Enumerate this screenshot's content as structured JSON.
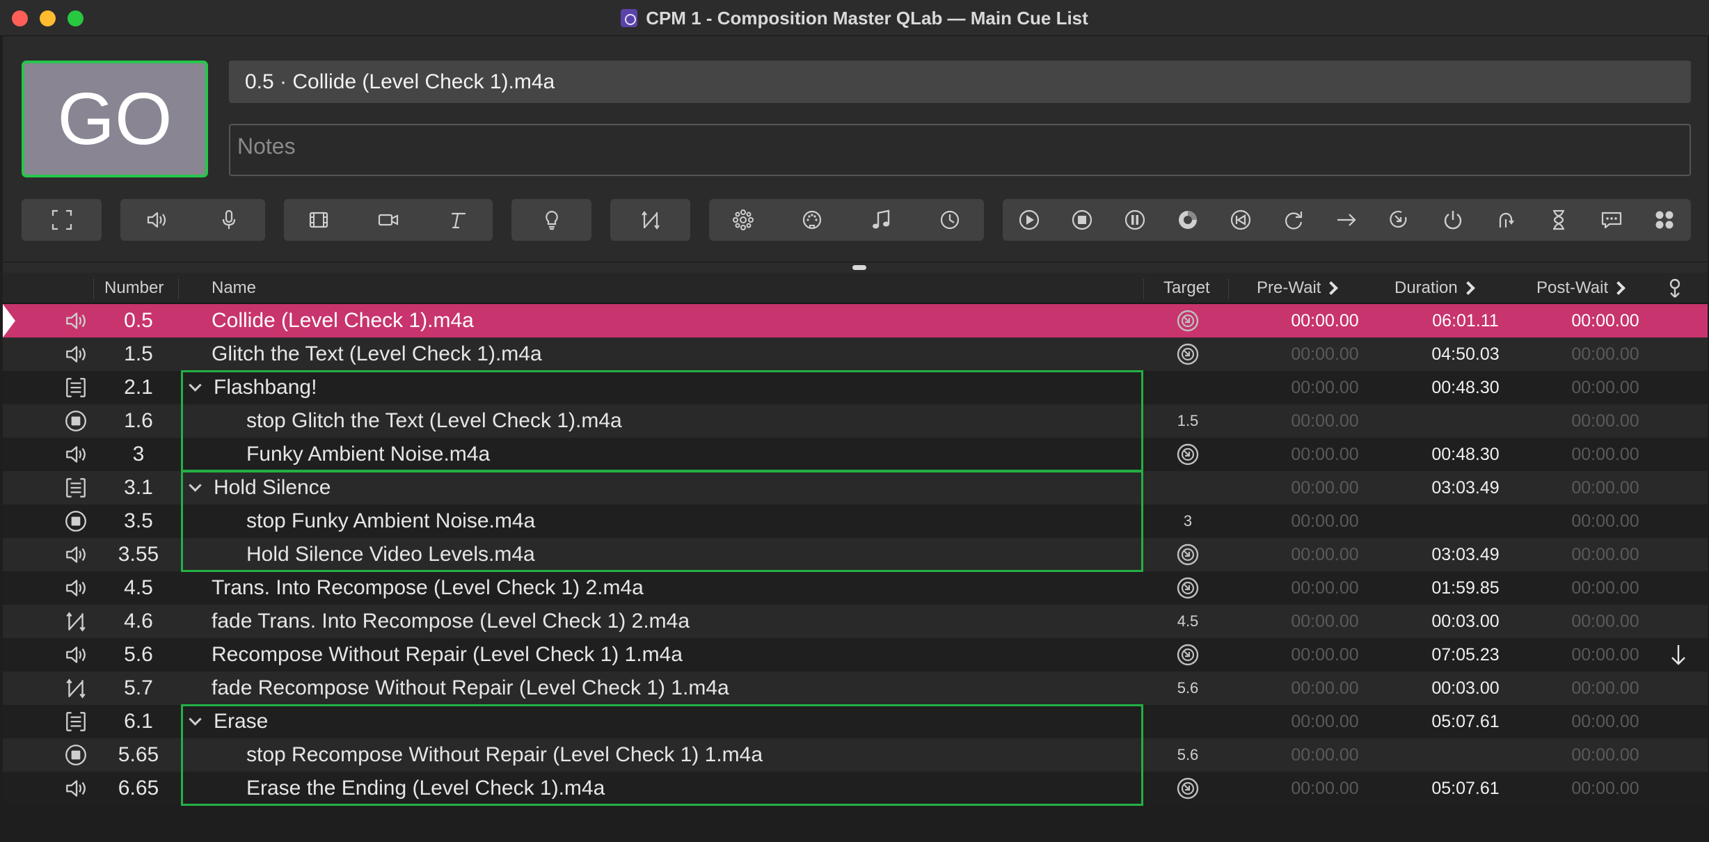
{
  "window": {
    "title": "CPM 1 - Composition Master QLab — Main Cue List"
  },
  "go_button": {
    "label": "GO"
  },
  "standby_cue": {
    "title": "0.5 · Collide (Level Check 1).m4a"
  },
  "notes": {
    "placeholder": "Notes"
  },
  "toolbar": {
    "groups": [
      [
        "fullscreen-icon"
      ],
      [
        "audio-cue-icon",
        "mic-cue-icon"
      ],
      [
        "video-cue-icon",
        "camera-cue-icon",
        "text-cue-icon"
      ],
      [
        "light-cue-icon"
      ],
      [
        "fade-cue-icon"
      ],
      [
        "network-cue-icon",
        "midi-cue-icon",
        "midi-file-cue-icon",
        "timecode-cue-icon"
      ],
      [
        "start-cue-icon",
        "stop-cue-icon",
        "pause-cue-icon",
        "load-cue-icon",
        "reset-cue-icon",
        "goto-cue-icon",
        "target-cue-icon",
        "arm-cue-icon",
        "disarm-cue-icon",
        "devamp-cue-icon",
        "wait-cue-icon",
        "memo-cue-icon",
        "script-cue-icon"
      ]
    ]
  },
  "table": {
    "headers": {
      "number": "Number",
      "name": "Name",
      "target": "Target",
      "prewait": "Pre-Wait",
      "duration": "Duration",
      "postwait": "Post-Wait"
    },
    "rows": [
      {
        "type": "audio",
        "number": "0.5",
        "name": "Collide (Level Check 1).m4a",
        "indent": 0,
        "target": "icon",
        "prewait": "00:00.00",
        "duration": "06:01.11",
        "postwait": "00:00.00",
        "selected": true
      },
      {
        "type": "audio",
        "number": "1.5",
        "name": "Glitch the Text (Level Check 1).m4a",
        "indent": 0,
        "target": "icon",
        "prewait": "00:00.00",
        "duration": "04:50.03",
        "postwait": "00:00.00"
      },
      {
        "type": "group",
        "number": "2.1",
        "name": "Flashbang!",
        "indent": 0,
        "target": "",
        "prewait": "00:00.00",
        "duration": "00:48.30",
        "postwait": "00:00.00"
      },
      {
        "type": "stop",
        "number": "1.6",
        "name": "stop Glitch the Text (Level Check 1).m4a",
        "indent": 1,
        "target": "1.5",
        "prewait": "00:00.00",
        "duration": "",
        "postwait": "00:00.00"
      },
      {
        "type": "audio",
        "number": "3",
        "name": "Funky Ambient Noise.m4a",
        "indent": 1,
        "target": "icon",
        "prewait": "00:00.00",
        "duration": "00:48.30",
        "postwait": "00:00.00"
      },
      {
        "type": "group",
        "number": "3.1",
        "name": "Hold Silence",
        "indent": 0,
        "target": "",
        "prewait": "00:00.00",
        "duration": "03:03.49",
        "postwait": "00:00.00"
      },
      {
        "type": "stop",
        "number": "3.5",
        "name": "stop Funky Ambient Noise.m4a",
        "indent": 1,
        "target": "3",
        "prewait": "00:00.00",
        "duration": "",
        "postwait": "00:00.00"
      },
      {
        "type": "audio",
        "number": "3.55",
        "name": "Hold Silence Video Levels.m4a",
        "indent": 1,
        "target": "icon",
        "prewait": "00:00.00",
        "duration": "03:03.49",
        "postwait": "00:00.00"
      },
      {
        "type": "audio",
        "number": "4.5",
        "name": "Trans. Into Recompose (Level Check 1) 2.m4a",
        "indent": 0,
        "target": "icon",
        "prewait": "00:00.00",
        "duration": "01:59.85",
        "postwait": "00:00.00"
      },
      {
        "type": "fade",
        "number": "4.6",
        "name": "fade Trans. Into Recompose (Level Check 1) 2.m4a",
        "indent": 0,
        "target": "4.5",
        "prewait": "00:00.00",
        "duration": "00:03.00",
        "postwait": "00:00.00"
      },
      {
        "type": "audio",
        "number": "5.6",
        "name": "Recompose Without Repair (Level Check 1) 1.m4a",
        "indent": 0,
        "target": "icon",
        "prewait": "00:00.00",
        "duration": "07:05.23",
        "postwait": "00:00.00",
        "continue": true
      },
      {
        "type": "fade",
        "number": "5.7",
        "name": "fade Recompose Without Repair (Level Check 1) 1.m4a",
        "indent": 0,
        "target": "5.6",
        "prewait": "00:00.00",
        "duration": "00:03.00",
        "postwait": "00:00.00"
      },
      {
        "type": "group",
        "number": "6.1",
        "name": "Erase",
        "indent": 0,
        "target": "",
        "prewait": "00:00.00",
        "duration": "05:07.61",
        "postwait": "00:00.00"
      },
      {
        "type": "stop",
        "number": "5.65",
        "name": "stop Recompose Without Repair (Level Check 1) 1.m4a",
        "indent": 1,
        "target": "5.6",
        "prewait": "00:00.00",
        "duration": "",
        "postwait": "00:00.00"
      },
      {
        "type": "audio",
        "number": "6.65",
        "name": "Erase the Ending (Level Check 1).m4a",
        "indent": 1,
        "target": "icon",
        "prewait": "00:00.00",
        "duration": "05:07.61",
        "postwait": "00:00.00"
      }
    ]
  },
  "colors": {
    "go_border": "#26c64b",
    "selected_row": "#c8346d",
    "group_outline": "#23b045"
  }
}
